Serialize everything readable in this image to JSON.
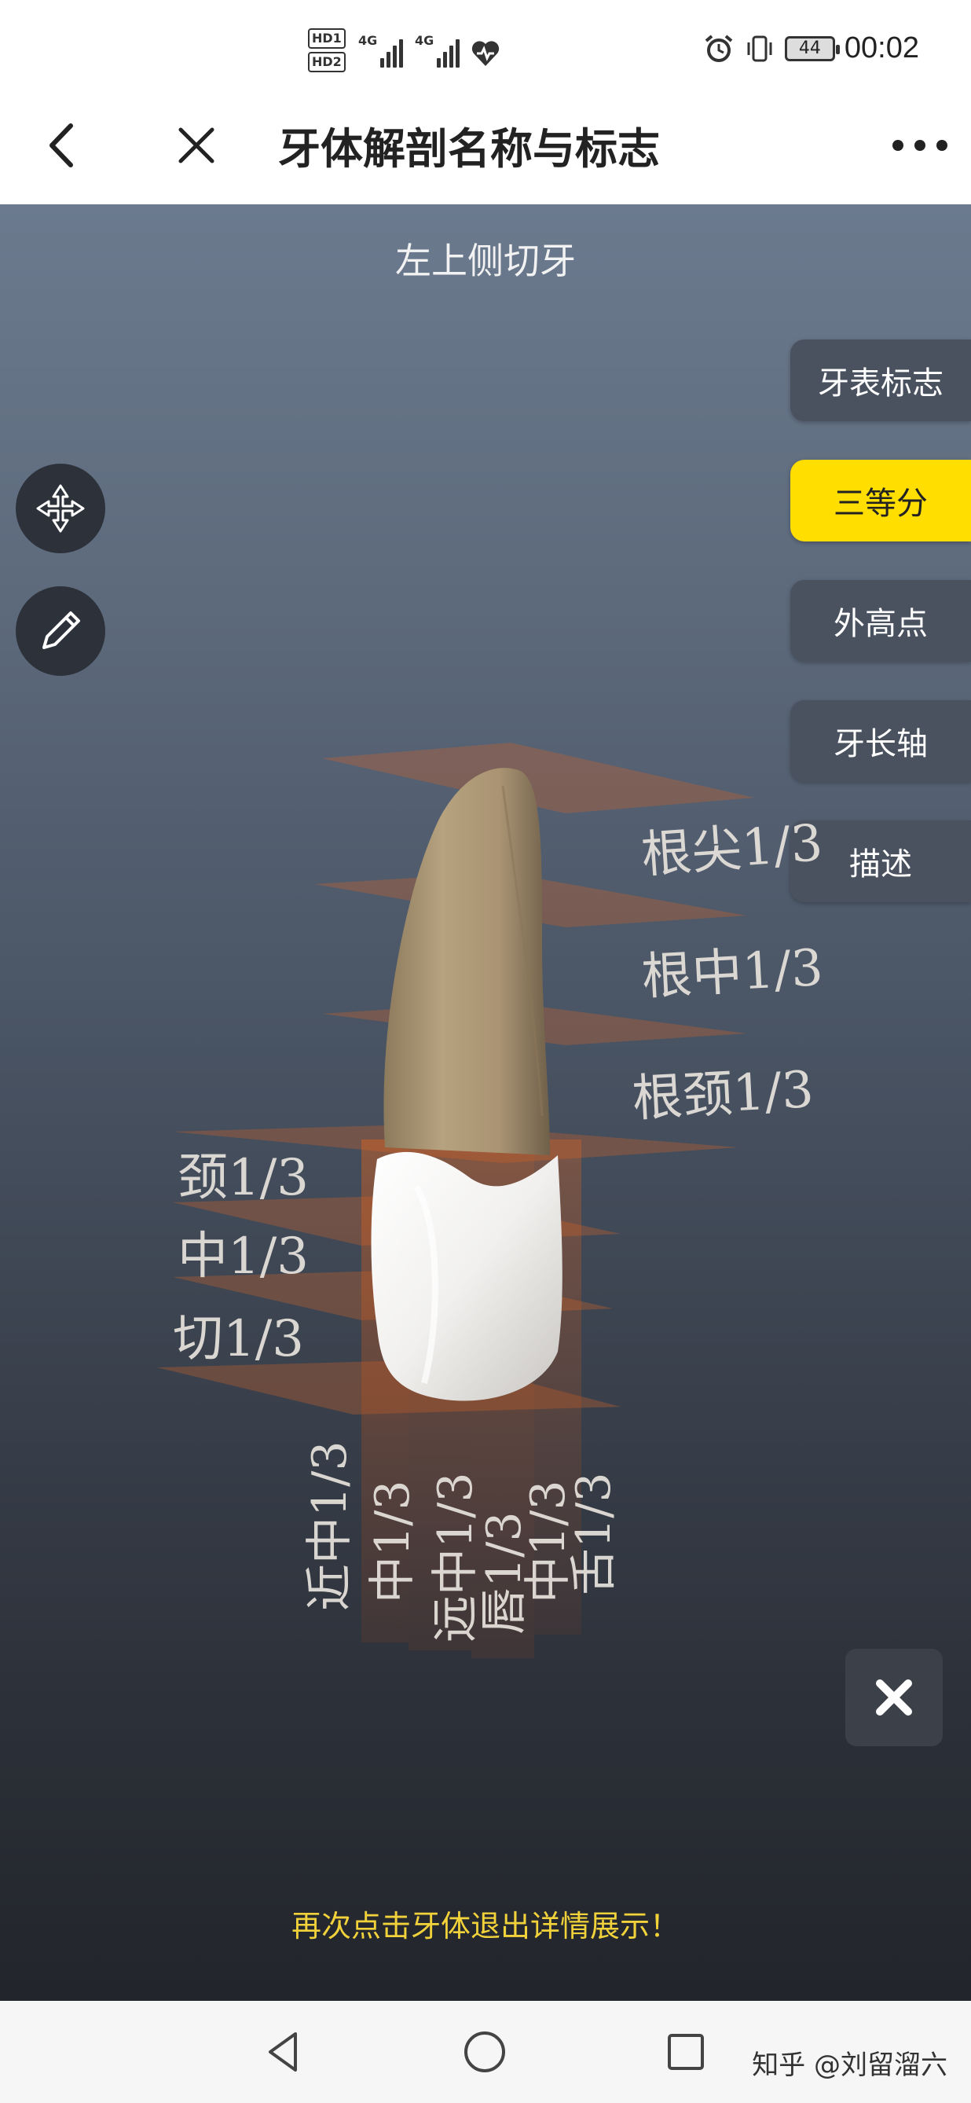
{
  "status_bar": {
    "hd1": "HD1",
    "hd2": "HD2",
    "net1": "4G",
    "net2": "4G",
    "battery": "44",
    "time": "00:02"
  },
  "header": {
    "title": "牙体解剖名称与标志",
    "back_icon": "chevron-left-icon",
    "close_icon": "close-icon",
    "more_icon": "more-dots-icon"
  },
  "viewer": {
    "tooth_name": "左上侧切牙",
    "side_buttons": [
      {
        "label": "牙表标志",
        "active": false
      },
      {
        "label": "三等分",
        "active": true
      },
      {
        "label": "外高点",
        "active": false
      },
      {
        "label": "牙长轴",
        "active": false
      },
      {
        "label": "描述",
        "active": false
      }
    ],
    "tools": [
      {
        "icon": "rotate-arrows-icon"
      },
      {
        "icon": "pencil-icon"
      }
    ],
    "root_labels": [
      "根尖1/3",
      "根中1/3",
      "根颈1/3"
    ],
    "crown_labels": [
      "颈1/3",
      "中1/3",
      "切1/3"
    ],
    "vertical_labels": [
      "近中1/3",
      "中1/3",
      "远中1/3",
      "唇1/3",
      "中1/3",
      "舌1/3"
    ],
    "close_icon": "close-x-icon",
    "hint": "再次点击牙体退出详情展示！"
  },
  "bottom_nav": {
    "back_icon": "triangle-back-icon",
    "home_icon": "circle-home-icon",
    "recent_icon": "square-recent-icon",
    "watermark": "知乎 @刘留溜六"
  },
  "colors": {
    "active": "#ffde00",
    "button": "#4a5260",
    "hint": "#f2d23a",
    "plane": "#c8622a"
  }
}
